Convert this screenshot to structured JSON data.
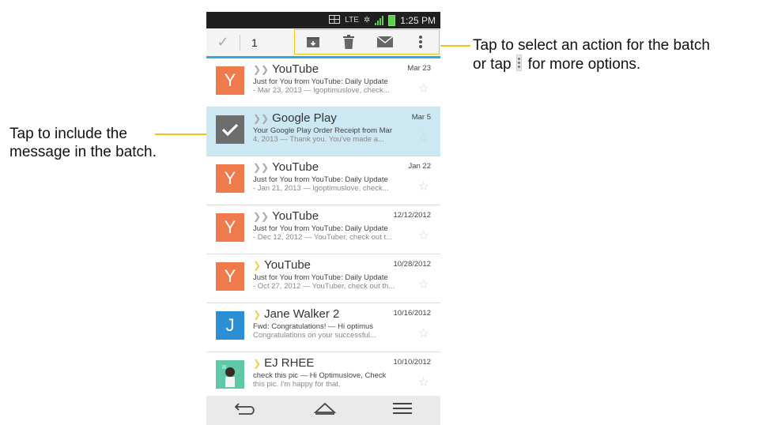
{
  "callouts": {
    "left_line1": "Tap to include the",
    "left_line2": "message in the batch.",
    "right_line1": "Tap to select an action for the batch",
    "right_line2_a": "or tap",
    "right_line2_b": "for more options."
  },
  "status_bar": {
    "network": "LTE",
    "time": "1:25 PM",
    "icons": [
      "dual-screen-icon",
      "lte-icon",
      "gps-icon",
      "signal-icon",
      "battery-icon"
    ]
  },
  "action_bar": {
    "selected_count": "1",
    "actions": [
      "archive-icon",
      "delete-icon",
      "mark-unread-icon",
      "more-options-icon"
    ]
  },
  "messages": [
    {
      "sender": "YouTube",
      "date": "Mar 23",
      "line1": "Just for You from YouTube: Daily Update",
      "line2": "- Mar 23, 2013 — lgoptimuslove, check...",
      "avatar_letter": "Y",
      "avatar_color": "#ef7a4c",
      "selected": false,
      "importance": "gray"
    },
    {
      "sender": "Google Play",
      "date": "Mar 5",
      "line1": "Your Google Play Order Receipt from Mar",
      "line2": "4, 2013 — Thank you. You've made a...",
      "avatar_letter": "",
      "avatar_color": "#6d6d6d",
      "selected": true,
      "importance": "gray"
    },
    {
      "sender": "YouTube",
      "date": "Jan 22",
      "line1": "Just for You from YouTube: Daily Update",
      "line2": "- Jan 21, 2013 — lgoptimuslove, check...",
      "avatar_letter": "Y",
      "avatar_color": "#ef7a4c",
      "selected": false,
      "importance": "gray"
    },
    {
      "sender": "YouTube",
      "date": "12/12/2012",
      "line1": "Just for You from YouTube: Daily Update",
      "line2": "- Dec 12, 2012 — YouTuber, check out t...",
      "avatar_letter": "Y",
      "avatar_color": "#ef7a4c",
      "selected": false,
      "importance": "gray"
    },
    {
      "sender": "YouTube",
      "date": "10/28/2012",
      "line1": "Just for You from YouTube: Daily Update",
      "line2": "- Oct 27, 2012 — YouTuber, check out th...",
      "avatar_letter": "Y",
      "avatar_color": "#ef7a4c",
      "selected": false,
      "importance": "yellow"
    },
    {
      "sender": "Jane Walker  2",
      "date": "10/16/2012",
      "line1": "Fwd: Congratulations! — Hi optimus",
      "line2": "Congratulations on your successful...",
      "avatar_letter": "J",
      "avatar_color": "#2c8fd5",
      "selected": false,
      "importance": "yellow"
    },
    {
      "sender": "EJ RHEE",
      "date": "10/10/2012",
      "line1": "check this pic — Hi Optimuslove, Check",
      "line2": "this pic. I'm happy for that.",
      "avatar_letter": "",
      "avatar_color": "#5ec8a8",
      "selected": false,
      "importance": "yellow"
    }
  ],
  "nav_bar": [
    "back-icon",
    "home-icon",
    "menu-icon"
  ],
  "colors": {
    "accent": "#33a7e0",
    "callout_line": "#f0c419",
    "selected_row": "#cbe8f3"
  }
}
